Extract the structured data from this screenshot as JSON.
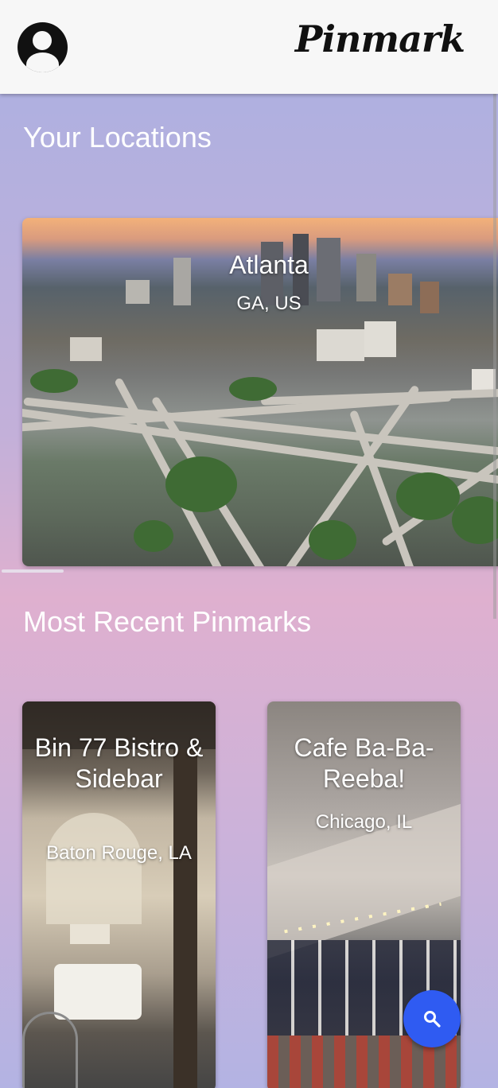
{
  "header": {
    "app_name": "Pinmark",
    "avatar_icon": "account-circle-icon"
  },
  "locations": {
    "title": "Your Locations",
    "items": [
      {
        "city": "Atlanta",
        "region": "GA, US"
      }
    ]
  },
  "recent": {
    "title": "Most Recent Pinmarks",
    "items": [
      {
        "name": "Bin 77 Bistro & Sidebar",
        "place": "Baton Rouge, LA"
      },
      {
        "name": "Cafe Ba-Ba-Reeba!",
        "place": "Chicago, IL"
      }
    ]
  },
  "fab": {
    "icon": "search-icon",
    "color": "#2f5bf2"
  },
  "colors": {
    "header_bg": "#f7f7f7",
    "accent": "#2f5bf2"
  }
}
